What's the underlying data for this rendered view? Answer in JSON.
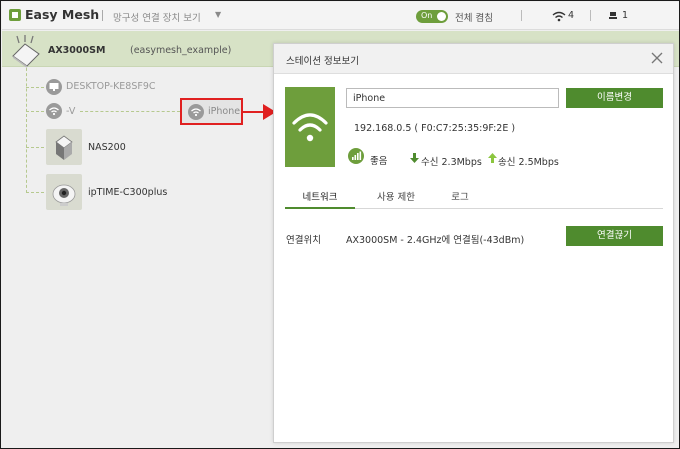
{
  "header": {
    "app_title": "Easy Mesh",
    "view_link": "망구성 연결 장치 보기",
    "toggle_label": "On",
    "all_on_label": "전체 켬침",
    "wifi_count": "4",
    "lan_count": "1"
  },
  "topology": {
    "router_name": "AX3000SM",
    "router_sub": "(easymesh_example)",
    "devices": [
      {
        "label": "DESKTOP-KE8SF9C",
        "icon": "monitor-icon"
      },
      {
        "label": "-V",
        "icon": "wifi-icon"
      },
      {
        "label": "iPhone",
        "icon": "wifi-icon"
      },
      {
        "label": "NAS200",
        "icon": "nas-icon"
      },
      {
        "label": "ipTIME-C300plus",
        "icon": "camera-icon"
      }
    ]
  },
  "panel": {
    "title": "스테이션 정보보기",
    "device_name_value": "iPhone",
    "rename_label": "이름변경",
    "ip_mac": "192.168.0.5 ( F0:C7:25:35:9F:2E )",
    "signal_label": "좋음",
    "rx_label": "수신 2.3Mbps",
    "tx_label": "송신 2.5Mbps",
    "tabs": [
      {
        "label": "네트워크",
        "active": true
      },
      {
        "label": "사용 제한",
        "active": false
      },
      {
        "label": "로그",
        "active": false
      }
    ],
    "connection_label": "연결위치",
    "connection_value": "AX3000SM - 2.4GHz에 연결됨(-43dBm)",
    "disconnect_label": "연결끊기"
  },
  "colors": {
    "accent_green": "#4f8b2e",
    "highlight_red": "#e02020",
    "router_band": "#d7e2c6"
  }
}
